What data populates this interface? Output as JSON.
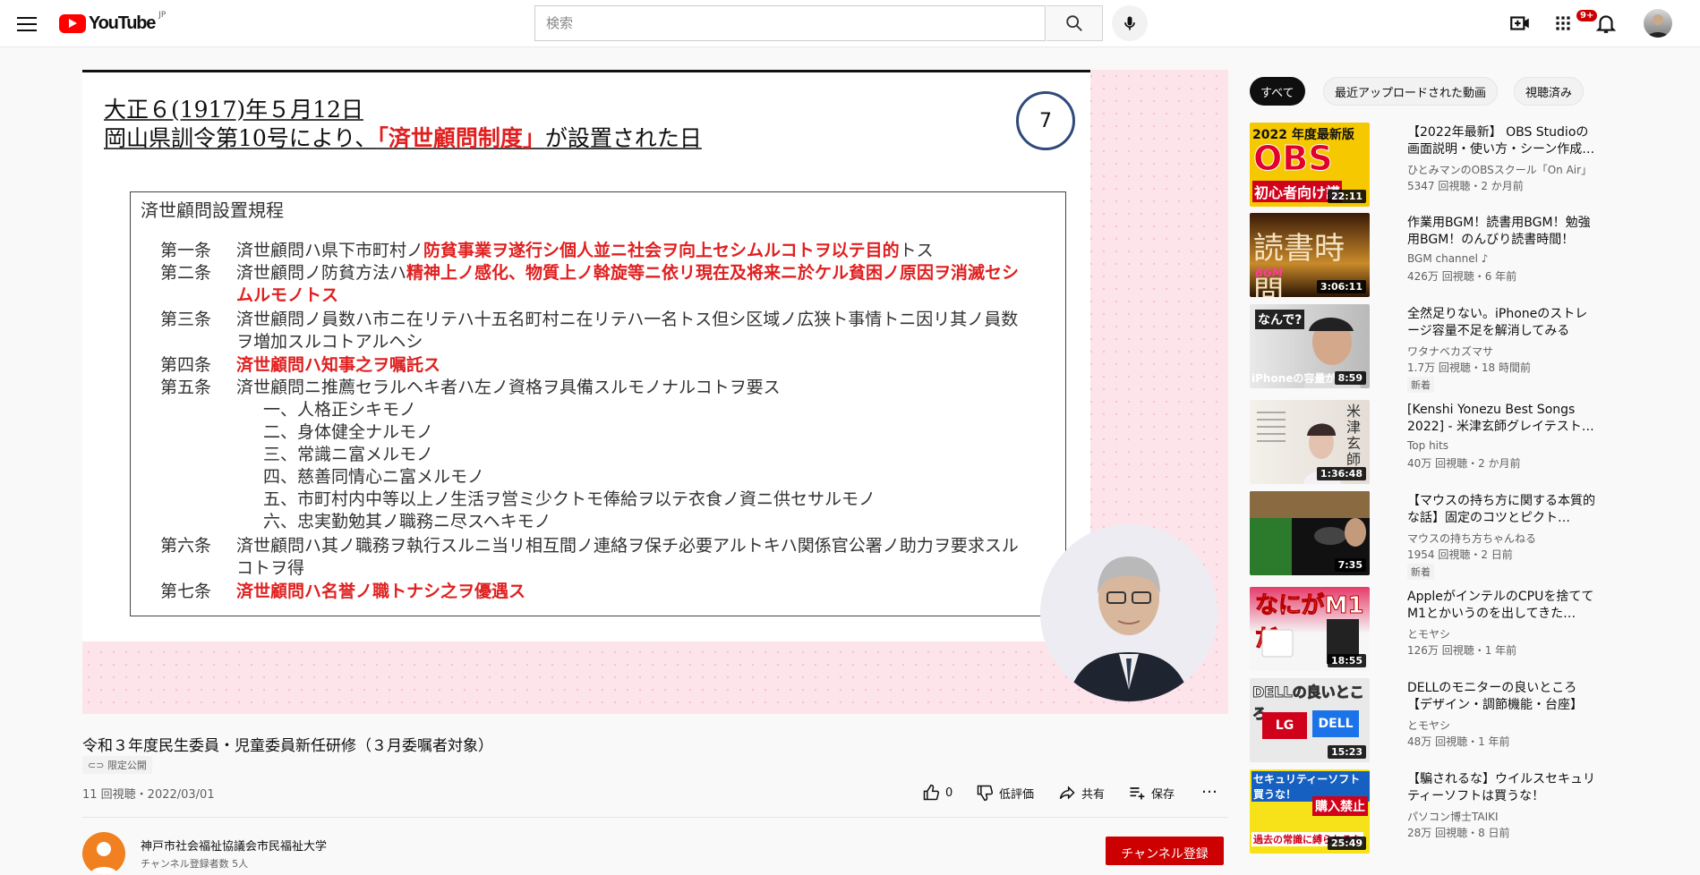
{
  "header": {
    "logo_text": "YouTube",
    "country": "JP",
    "search_placeholder": "検索",
    "notification_count": "9+"
  },
  "slide": {
    "title_line1": "大正６(1917)年５月12日",
    "title_line2_pre": "岡山県訓令第10号により、",
    "title_line2_red": "「済世顧問制度」",
    "title_line2_post": "が設置された日",
    "slide_number": "7",
    "regulation_heading": "済世顧問設置規程",
    "articles": [
      {
        "num": "第一条",
        "plain": "済世顧問ハ県下市町村ノ",
        "red": "防貧事業ヲ遂行シ個人並ニ社会ヲ向上セシムルコトヲ以テ目的",
        "after": "トス"
      },
      {
        "num": "第二条",
        "plain": "済世顧問ノ防貧方法ハ",
        "red": "精神上ノ感化、物質上ノ斡旋等ニ依リ現在及将来ニ於ケル貧困ノ原因ヲ消滅セシムルモノトス",
        "after": ""
      },
      {
        "num": "第三条",
        "plain": "済世顧問ノ員数ハ市ニ在リテハ十五名町村ニ在リテハ一名トス但シ区域ノ広狭ト事情トニ因リ其ノ員数ヲ増加スルコトアルヘシ",
        "red": "",
        "after": ""
      },
      {
        "num": "第四条",
        "plain": "",
        "red": "済世顧問ハ知事之ヲ嘱託ス",
        "after": ""
      },
      {
        "num": "第五条",
        "plain": "済世顧問ニ推薦セラルヘキ者ハ左ノ資格ヲ具備スルモノナルコトヲ要ス",
        "red": "",
        "after": ""
      },
      {
        "num": "第六条",
        "plain": "済世顧問ハ其ノ職務ヲ執行スルニ当リ相互間ノ連絡ヲ保チ必要アルトキハ関係官公署ノ助力ヲ要求スルコトヲ得",
        "red": "",
        "after": ""
      },
      {
        "num": "第七条",
        "plain": "",
        "red": "済世顧問ハ名誉ノ職トナシ之ヲ優遇ス",
        "after": ""
      }
    ],
    "qualifications": [
      "一、人格正シキモノ",
      "二、身体健全ナルモノ",
      "三、常識ニ富メルモノ",
      "四、慈善同情心ニ富メルモノ",
      "五、市町村内中等以上ノ生活ヲ営ミ少クトモ俸給ヲ以テ衣食ノ資ニ供セサルモノ",
      "六、忠実勤勉其ノ職務ニ尽スヘキモノ"
    ]
  },
  "video": {
    "title": "令和３年度民生委員・児童委員新任研修（３月委嘱者対象）",
    "visibility": "限定公開",
    "views_date": "11 回視聴・2022/03/01",
    "like_count": "0",
    "dislike_label": "低評価",
    "share_label": "共有",
    "save_label": "保存",
    "channel_name": "神戸市社会福祉協議会市民福祉大学",
    "channel_subs": "チャンネル登録者数 5人",
    "subscribe_label": "チャンネル登録"
  },
  "filters": [
    "すべて",
    "最近アップロードされた動画",
    "視聴済み"
  ],
  "recommendations": [
    {
      "title": "【2022年最新】 OBS Studioの画面説明・使い方・シーン作成…",
      "channel": "ひとみマンのOBSスクール「On Air」",
      "meta": "5347 回視聴・2 か月前",
      "duration": "22:11",
      "badge": "",
      "thumb_text": "OBS",
      "thumb_sub": "2022 年度最新版",
      "thumb_bottom": "初心者向け講"
    },
    {
      "title": "作業用BGM！読書用BGM！勉強用BGM！のんびり読書時間！",
      "channel": "BGM channel ♪",
      "meta": "426万 回視聴・6 年前",
      "duration": "3:06:11",
      "badge": "",
      "thumb_text": "読書時間",
      "thumb_sub": "BGM",
      "thumb_bottom": ""
    },
    {
      "title": "全然足りない。iPhoneのストレージ容量不足を解消してみる",
      "channel": "ワタナベカズマサ",
      "meta": "1.7万 回視聴・18 時間前",
      "duration": "8:59",
      "badge": "新着",
      "thumb_text": "なんで?",
      "thumb_sub": "",
      "thumb_bottom": "iPhoneの容量が足り"
    },
    {
      "title": "[Kenshi Yonezu Best Songs 2022] - 米津玄師グレイテスト…",
      "channel": "Top hits",
      "meta": "40万 回視聴・2 か月前",
      "duration": "1:36:48",
      "badge": "",
      "thumb_text": "米津玄師",
      "thumb_sub": "",
      "thumb_bottom": ""
    },
    {
      "title": "【マウスの持ち方に関する本質的な話】固定のコツとピクト…",
      "channel": "マウスの持ち方ちゃんねる",
      "meta": "1954 回視聴・2 日前",
      "duration": "7:35",
      "badge": "新着",
      "thumb_text": "",
      "thumb_sub": "",
      "thumb_bottom": ""
    },
    {
      "title": "AppleがインテルのCPUを捨ててM1とかいうのを出してきた…",
      "channel": "とモヤシ",
      "meta": "126万 回視聴・1 年前",
      "duration": "18:55",
      "badge": "",
      "thumb_text": "なにがM1だ",
      "thumb_sub": "",
      "thumb_bottom": ""
    },
    {
      "title": "DELLのモニターの良いところ【デザイン・調節機能・台座】",
      "channel": "とモヤシ",
      "meta": "48万 回視聴・1 年前",
      "duration": "15:23",
      "badge": "",
      "thumb_text": "DELLの良いところ",
      "thumb_sub": "LG",
      "thumb_bottom": "DELL"
    },
    {
      "title": "【騙されるな】ウイルスセキュリティーソフトは買うな！",
      "channel": "パソコン博士TAIKI",
      "meta": "28万 回視聴・8 日前",
      "duration": "25:49",
      "badge": "",
      "thumb_text": "セキュリティーソフト買うな！",
      "thumb_sub": "購入禁止",
      "thumb_bottom": "過去の常識に縛られるな"
    }
  ],
  "colors": {
    "brand_red": "#ff0000",
    "subscribe_red": "#cc0000",
    "slide_red": "#e02020"
  }
}
